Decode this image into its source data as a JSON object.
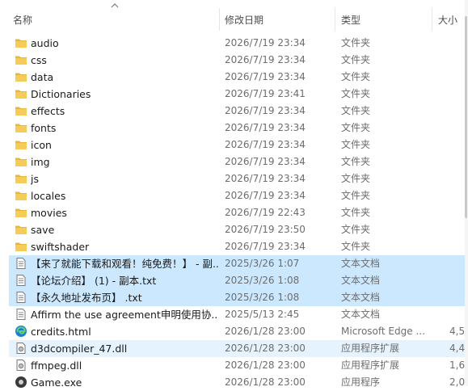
{
  "header": {
    "name": "名称",
    "date_modified": "修改日期",
    "type": "类型",
    "size": "大小"
  },
  "files": [
    {
      "icon": "folder-icon",
      "name": "audio",
      "date": "2026/7/19 23:34",
      "type": "文件夹",
      "size": "",
      "state": "normal"
    },
    {
      "icon": "folder-icon",
      "name": "css",
      "date": "2026/7/19 23:34",
      "type": "文件夹",
      "size": "",
      "state": "normal"
    },
    {
      "icon": "folder-icon",
      "name": "data",
      "date": "2026/7/19 23:34",
      "type": "文件夹",
      "size": "",
      "state": "normal"
    },
    {
      "icon": "folder-icon",
      "name": "Dictionaries",
      "date": "2026/7/19 23:41",
      "type": "文件夹",
      "size": "",
      "state": "normal"
    },
    {
      "icon": "folder-icon",
      "name": "effects",
      "date": "2026/7/19 23:34",
      "type": "文件夹",
      "size": "",
      "state": "normal"
    },
    {
      "icon": "folder-icon",
      "name": "fonts",
      "date": "2026/7/19 23:34",
      "type": "文件夹",
      "size": "",
      "state": "normal"
    },
    {
      "icon": "folder-icon",
      "name": "icon",
      "date": "2026/7/19 23:34",
      "type": "文件夹",
      "size": "",
      "state": "normal"
    },
    {
      "icon": "folder-icon",
      "name": "img",
      "date": "2026/7/19 23:34",
      "type": "文件夹",
      "size": "",
      "state": "normal"
    },
    {
      "icon": "folder-icon",
      "name": "js",
      "date": "2026/7/19 23:34",
      "type": "文件夹",
      "size": "",
      "state": "normal"
    },
    {
      "icon": "folder-icon",
      "name": "locales",
      "date": "2026/7/19 23:34",
      "type": "文件夹",
      "size": "",
      "state": "normal"
    },
    {
      "icon": "folder-icon",
      "name": "movies",
      "date": "2026/7/19 22:43",
      "type": "文件夹",
      "size": "",
      "state": "normal"
    },
    {
      "icon": "folder-icon",
      "name": "save",
      "date": "2026/7/19 23:50",
      "type": "文件夹",
      "size": "",
      "state": "normal"
    },
    {
      "icon": "folder-icon",
      "name": "swiftshader",
      "date": "2026/7/19 23:34",
      "type": "文件夹",
      "size": "",
      "state": "normal"
    },
    {
      "icon": "text-file-icon",
      "name": "【来了就能下载和观看！纯免费！】 - 副...",
      "date": "2025/3/26 1:07",
      "type": "文本文档",
      "size": "",
      "state": "selected"
    },
    {
      "icon": "text-file-icon",
      "name": "【论坛介绍】 (1) - 副本.txt",
      "date": "2025/3/26 1:08",
      "type": "文本文档",
      "size": "",
      "state": "selected"
    },
    {
      "icon": "text-file-icon",
      "name": "【永久地址发布页】 .txt",
      "date": "2025/3/26 1:08",
      "type": "文本文档",
      "size": "",
      "state": "selected"
    },
    {
      "icon": "text-file-icon",
      "name": "Affirm the use agreement申明使用协...",
      "date": "2025/5/13 2:45",
      "type": "文本文档",
      "size": "",
      "state": "normal"
    },
    {
      "icon": "edge-icon",
      "name": "credits.html",
      "date": "2026/1/28 23:00",
      "type": "Microsoft Edge ...",
      "size": "4,5",
      "state": "normal"
    },
    {
      "icon": "dll-file-icon",
      "name": "d3dcompiler_47.dll",
      "date": "2026/1/28 23:00",
      "type": "应用程序扩展",
      "size": "4,4",
      "state": "hover"
    },
    {
      "icon": "dll-file-icon",
      "name": "ffmpeg.dll",
      "date": "2026/1/28 23:00",
      "type": "应用程序扩展",
      "size": "1,6",
      "state": "normal"
    },
    {
      "icon": "exe-icon",
      "name": "Game.exe",
      "date": "2026/1/28 23:00",
      "type": "应用程序",
      "size": "2,0",
      "state": "normal"
    }
  ],
  "colors": {
    "selected": "#cce8ff",
    "hover": "#e5f3ff",
    "folder": "#f0c04a"
  }
}
